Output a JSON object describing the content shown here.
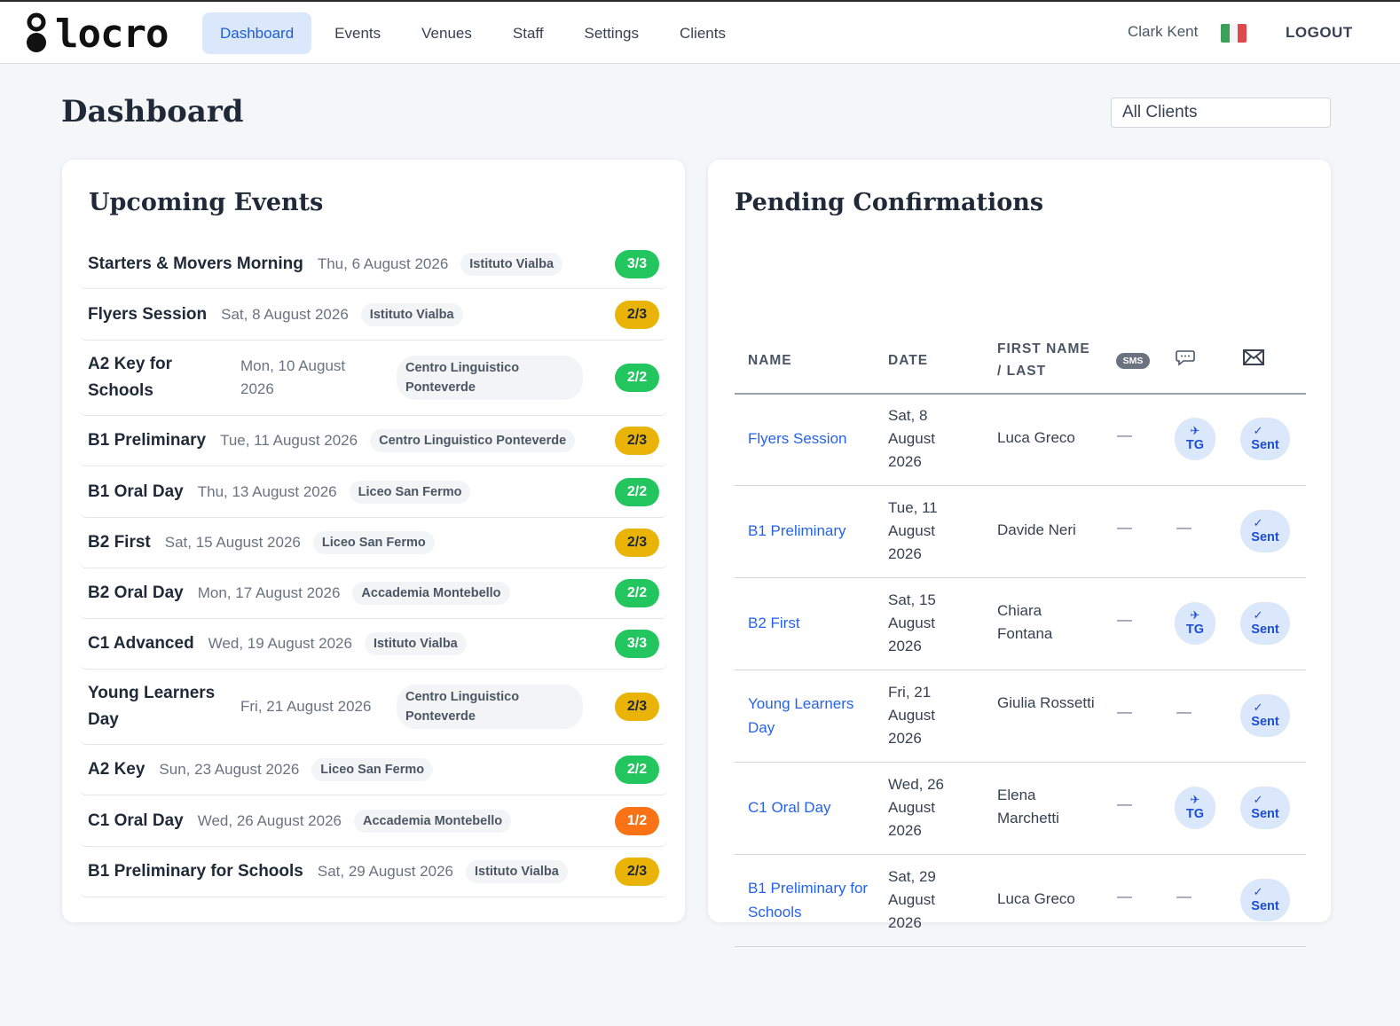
{
  "app": {
    "logo_text": "locro",
    "nav": [
      "Dashboard",
      "Events",
      "Venues",
      "Staff",
      "Settings",
      "Clients"
    ],
    "active_nav": "Dashboard",
    "user_name": "Clark Kent",
    "language_flag": "italy-flag-icon",
    "logout_label": "LOGOUT"
  },
  "page": {
    "title": "Dashboard",
    "client_filter": "All Clients"
  },
  "upcoming": {
    "title": "Upcoming Events",
    "events": [
      {
        "name": "Starters & Movers Morning",
        "date": "Thu, 6 August 2026",
        "venue": "Istituto Vialba",
        "staff": "3/3",
        "status": "full"
      },
      {
        "name": "Flyers Session",
        "date": "Sat, 8 August 2026",
        "venue": "Istituto Vialba",
        "staff": "2/3",
        "status": "partial"
      },
      {
        "name": "A2 Key for Schools",
        "date": "Mon, 10 August 2026",
        "venue": "Centro Linguistico Ponteverde",
        "staff": "2/2",
        "status": "full"
      },
      {
        "name": "B1 Preliminary",
        "date": "Tue, 11 August 2026",
        "venue": "Centro Linguistico Ponteverde",
        "staff": "2/3",
        "status": "partial"
      },
      {
        "name": "B1 Oral Day",
        "date": "Thu, 13 August 2026",
        "venue": "Liceo San Fermo",
        "staff": "2/2",
        "status": "full"
      },
      {
        "name": "B2 First",
        "date": "Sat, 15 August 2026",
        "venue": "Liceo San Fermo",
        "staff": "2/3",
        "status": "partial"
      },
      {
        "name": "B2 Oral Day",
        "date": "Mon, 17 August 2026",
        "venue": "Accademia Montebello",
        "staff": "2/2",
        "status": "full"
      },
      {
        "name": "C1 Advanced",
        "date": "Wed, 19 August 2026",
        "venue": "Istituto Vialba",
        "staff": "3/3",
        "status": "full"
      },
      {
        "name": "Young Learners Day",
        "date": "Fri, 21 August 2026",
        "venue": "Centro Linguistico Ponteverde",
        "staff": "2/3",
        "status": "partial"
      },
      {
        "name": "A2 Key",
        "date": "Sun, 23 August 2026",
        "venue": "Liceo San Fermo",
        "staff": "2/2",
        "status": "full"
      },
      {
        "name": "C1 Oral Day",
        "date": "Wed, 26 August 2026",
        "venue": "Accademia Montebello",
        "staff": "1/2",
        "status": "low"
      },
      {
        "name": "B1 Preliminary for Schools",
        "date": "Sat, 29 August 2026",
        "venue": "Istituto Vialba",
        "staff": "2/3",
        "status": "partial"
      }
    ]
  },
  "pending": {
    "title": "Pending Confirmations",
    "headers": {
      "name": "NAME",
      "date": "DATE",
      "person": "FIRST NAME / LAST",
      "sms": "SMS",
      "chat_icon": "speech-bubble-icon",
      "email_icon": "envelope-icon"
    },
    "rows": [
      {
        "event": "Flyers Session",
        "date": "Sat, 8 August 2026",
        "person": "Luca Greco",
        "sms": "—",
        "telegram": "TG",
        "email": "Sent"
      },
      {
        "event": "B1 Preliminary",
        "date": "Tue, 11 August 2026",
        "person": "Davide Neri",
        "sms": "—",
        "telegram": "—",
        "email": "Sent"
      },
      {
        "event": "B2 First",
        "date": "Sat, 15 August 2026",
        "person": "Chiara Fontana",
        "sms": "—",
        "telegram": "TG",
        "email": "Sent"
      },
      {
        "event": "Young Learners Day",
        "date": "Fri, 21 August 2026",
        "person": "Giulia Rossetti",
        "sms": "—",
        "telegram": "—",
        "email": "Sent"
      },
      {
        "event": "C1 Oral Day",
        "date": "Wed, 26 August 2026",
        "person": "Elena Marchetti",
        "sms": "—",
        "telegram": "TG",
        "email": "Sent"
      },
      {
        "event": "B1 Preliminary for Schools",
        "date": "Sat, 29 August 2026",
        "person": "Luca Greco",
        "sms": "—",
        "telegram": "—",
        "email": "Sent"
      }
    ]
  },
  "colors": {
    "accent": "#1d5fd6",
    "badge_full": "#22c55e",
    "badge_partial": "#eab308",
    "badge_low": "#f97316",
    "flag_green": "#3aa05a",
    "flag_white": "#f4f4f4",
    "flag_red": "#e0484d"
  }
}
